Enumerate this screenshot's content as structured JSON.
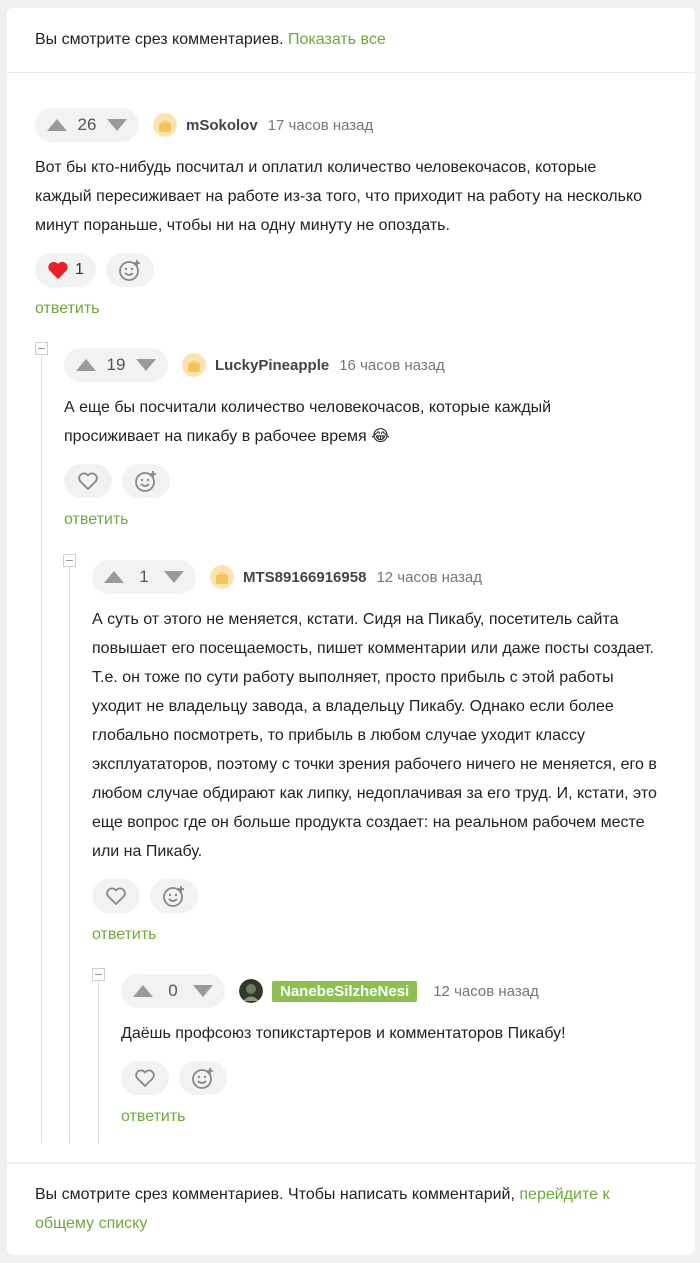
{
  "top_banner": {
    "text": "Вы смотрите срез комментариев.",
    "link": "Показать все"
  },
  "comments": [
    {
      "votes": "26",
      "username": "mSokolov",
      "time": "17 часов назад",
      "text": "Вот бы кто-нибудь посчитал и оплатил количество человекочасов, которые каждый пересиживает на работе из-за того, что приходит на работу на несколько минут пораньше, чтобы ни на одну минуту не опоздать.",
      "like_count": "1",
      "reply": "ответить"
    },
    {
      "votes": "19",
      "username": "LuckyPineapple",
      "time": "16 часов назад",
      "text": "А еще бы посчитали количество человекочасов, которые каждый просиживает на пикабу в рабочее время 😂",
      "reply": "ответить"
    },
    {
      "votes": "1",
      "username": "MTS89166916958",
      "time": "12 часов назад",
      "text": "А суть от этого не меняется, кстати. Сидя на Пикабу, посетитель сайта повышает его посещаемость, пишет комментарии или даже посты создает. Т.е. он тоже по сути работу выполняет, просто прибыль с этой работы уходит не владельцу завода, а владельцу Пикабу. Однако если более глобально посмотреть, то прибыль в любом случае уходит классу эксплуататоров, поэтому с точки зрения рабочего ничего не меняется, его в любом случае обдирают как липку, недоплачивая за его труд. И, кстати, это еще вопрос где он больше продукта создает: на реальном рабочем месте или на Пикабу.",
      "reply": "ответить"
    },
    {
      "votes": "0",
      "username": "NanebeSilzheNesi",
      "time": "12 часов назад",
      "text": "Даёшь профсоюз топикстартеров и комментаторов Пикабу!",
      "reply": "ответить"
    }
  ],
  "bottom_banner": {
    "text": "Вы смотрите срез комментариев. Чтобы написать комментарий,",
    "link": "перейдите к общему списку"
  },
  "colors": {
    "accent_green": "#6bab3a",
    "badge_green": "#8cc152",
    "heart_red": "#e8202a"
  },
  "icons": [
    "upvote-icon",
    "downvote-icon",
    "heart-icon",
    "add-reaction-icon",
    "collapse-icon",
    "avatar"
  ]
}
